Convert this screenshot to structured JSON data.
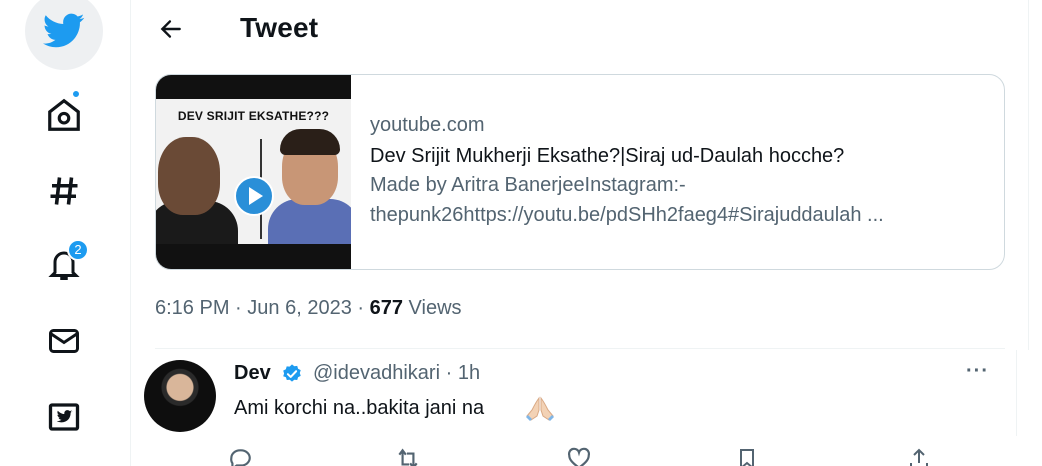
{
  "header": {
    "title": "Tweet",
    "back_icon": "arrow-left-icon"
  },
  "nav": {
    "items": [
      {
        "name": "twitter-logo",
        "icon": "bird-icon"
      },
      {
        "name": "home",
        "icon": "home-icon",
        "has_dot": true
      },
      {
        "name": "explore",
        "icon": "hashtag-icon"
      },
      {
        "name": "notifications",
        "icon": "bell-icon",
        "badge": "2"
      },
      {
        "name": "messages",
        "icon": "envelope-icon"
      },
      {
        "name": "twitter-blue",
        "icon": "twitter-blue-icon"
      }
    ],
    "accent": "#1d9bf0"
  },
  "card": {
    "thumbnail_title": "DEV SRIJIT EKSATHE???",
    "domain": "youtube.com",
    "headline": "Dev Srijit Mukherji Eksathe?|Siraj ud-Daulah hocche?",
    "desc_line1": "Made by Aritra BanerjeeInstagram:-",
    "desc_line2": "thepunk26https://youtu.be/pdSHh2faeg4#Sirajuddaulah ..."
  },
  "meta": {
    "time": "6:16 PM",
    "sep": "·",
    "date": "Jun 6, 2023",
    "views_count": "677",
    "views_label": "Views"
  },
  "reply": {
    "name": "Dev",
    "handle": "@idevadhikari",
    "sep": "·",
    "age": "1h",
    "more": "···",
    "text": "Ami korchi na..bakita jani na",
    "emoji": "folded-hands-icon"
  },
  "colors": {
    "text_primary": "#0f1419",
    "text_secondary": "#536471",
    "border": "#cfd9de",
    "accent": "#1d9bf0"
  }
}
